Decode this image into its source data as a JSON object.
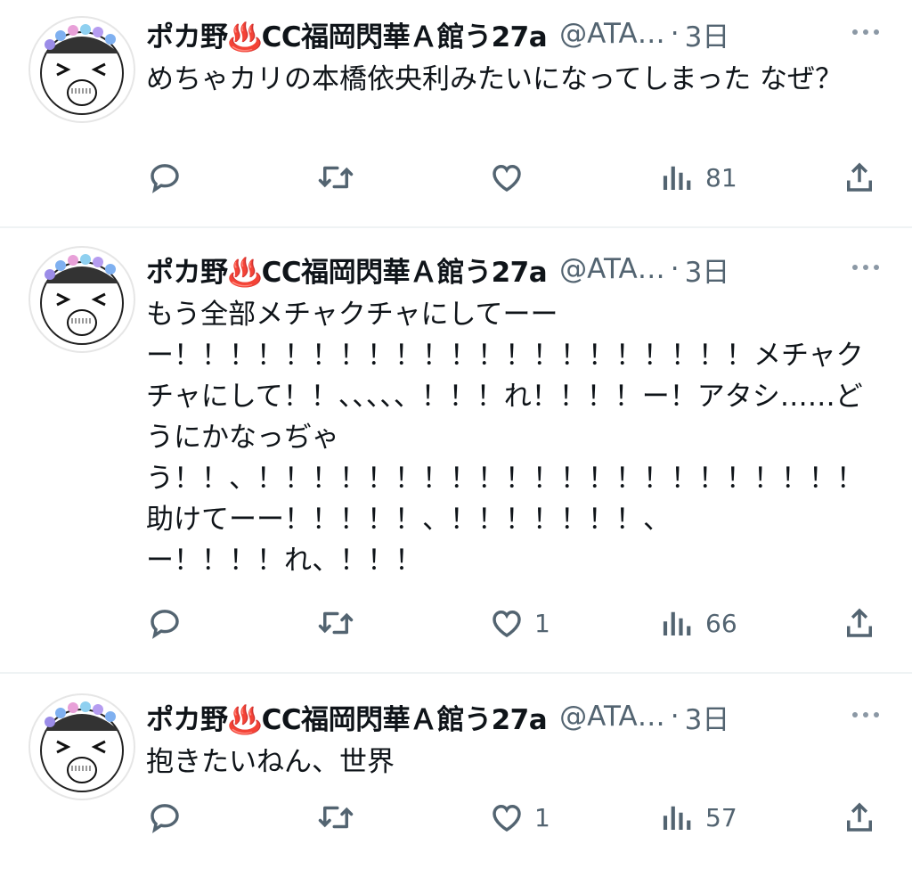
{
  "tweets": [
    {
      "name": "ポカ野♨️CC福岡閃華Ａ館う27a",
      "handle": "@ATA…",
      "time": "3日",
      "text": "めちゃカリの本橋依央利みたいになってしまった なぜ？",
      "replies": "",
      "likes": "",
      "views": "81"
    },
    {
      "name": "ポカ野♨️CC福岡閃華Ａ館う27a",
      "handle": "@ATA…",
      "time": "3日",
      "text": "もう全部メチャクチャにしてーー\nー！！！！！！！！！！！！！！！！！！！！！メチャクチャにして！！、、、、、！！！れ！！！！ー！アタシ……どうにかなっぢゃ\nう！！、！！！！！！！！！！！！！！！！！！！！！！助けてーー！！！！！、！！！！！！！、\nー！！！！れ、！！！",
      "replies": "",
      "likes": "1",
      "views": "66"
    },
    {
      "name": "ポカ野♨️CC福岡閃華Ａ館う27a",
      "handle": "@ATA…",
      "time": "3日",
      "text": "抱きたいねん、世界",
      "replies": "",
      "likes": "1",
      "views": "57"
    }
  ],
  "separator": "·",
  "icons": {
    "reply": "reply-icon",
    "retweet": "retweet-icon",
    "like": "heart-icon",
    "views": "views-icon",
    "share": "share-icon",
    "more": "more-icon",
    "avatar": "avatar-image"
  },
  "colors": {
    "text": "#0f1419",
    "secondary": "#536471",
    "divider": "#eff3f4"
  }
}
